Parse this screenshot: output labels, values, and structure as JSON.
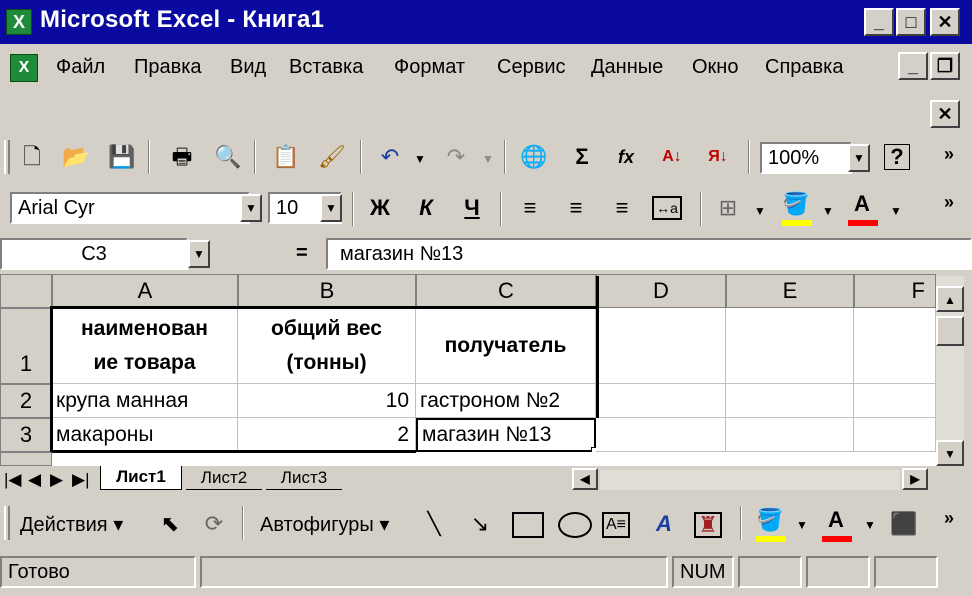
{
  "window": {
    "title": "Microsoft Excel - Книга1",
    "app_icon_letter": "X"
  },
  "menu": {
    "items": [
      "Файл",
      "Правка",
      "Вид",
      "Вставка",
      "Формат",
      "Сервис",
      "Данные",
      "Окно",
      "Справка"
    ]
  },
  "toolbar": {
    "zoom": "100%",
    "font_name": "Arial Cyr",
    "font_size": "10",
    "bold_label": "Ж",
    "italic_label": "К",
    "underline_label": "Ч"
  },
  "formula_bar": {
    "cell_ref": "C3",
    "equals": "=",
    "value": "магазин №13"
  },
  "sheet": {
    "columns": [
      "A",
      "B",
      "C",
      "D",
      "E",
      "F"
    ],
    "rows": [
      "1",
      "2",
      "3"
    ],
    "cells": {
      "A1": "наименован ие товара",
      "A1_line1": "наименован",
      "A1_line2": "ие товара",
      "B1_line1": "общий вес",
      "B1_line2": "(тонны)",
      "C1": "получатель",
      "A2": "крупа манная",
      "B2": "10",
      "C2": "гастроном №2",
      "A3": "макароны",
      "B3": "2",
      "C3": "магазин №13"
    }
  },
  "sheet_tabs": [
    "Лист1",
    "Лист2",
    "Лист3"
  ],
  "drawing_toolbar": {
    "actions_label": "Действия",
    "autoshapes_label": "Автофигуры"
  },
  "status": {
    "ready": "Готово",
    "num": "NUM"
  },
  "colors": {
    "titlebar": "#0a0aa0",
    "highlight_yellow": "#ffff00",
    "font_red": "#ff0000"
  }
}
